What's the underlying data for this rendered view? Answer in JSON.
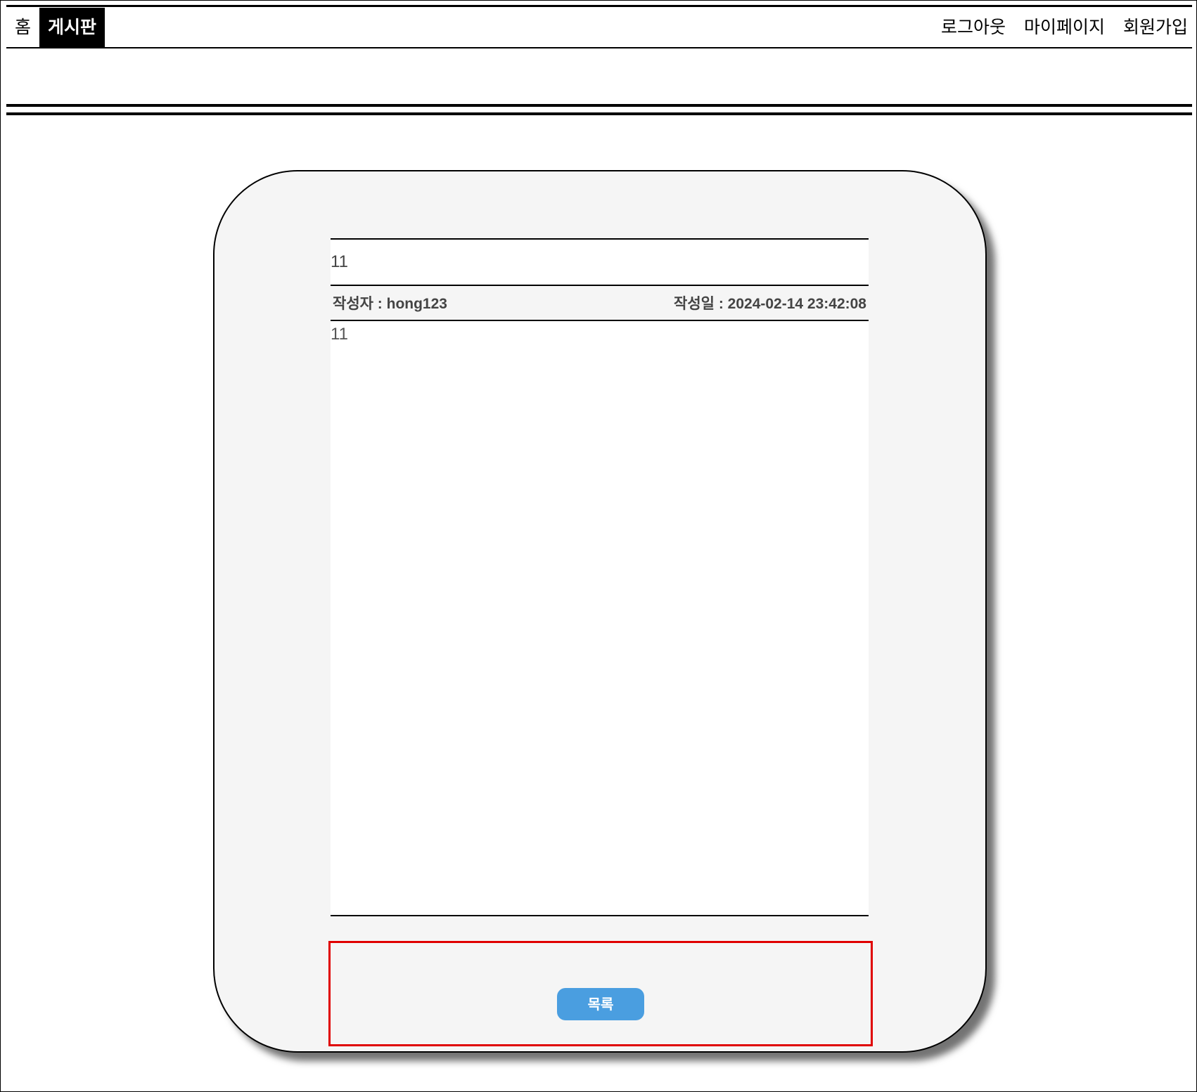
{
  "nav": {
    "left_items": [
      {
        "label": "홈",
        "active": false
      },
      {
        "label": "게시판",
        "active": true
      }
    ],
    "right_items": [
      {
        "label": "로그아웃"
      },
      {
        "label": "마이페이지"
      },
      {
        "label": "회원가입"
      }
    ]
  },
  "post": {
    "title": "11",
    "author_label": "작성자 : ",
    "author": "hong123",
    "date_label": "작성일 : ",
    "date": "2024-02-14 23:42:08",
    "content": "11"
  },
  "actions": {
    "list_button_label": "목록",
    "highlight_color": "#e00000",
    "button_color": "#4a9ee0"
  }
}
